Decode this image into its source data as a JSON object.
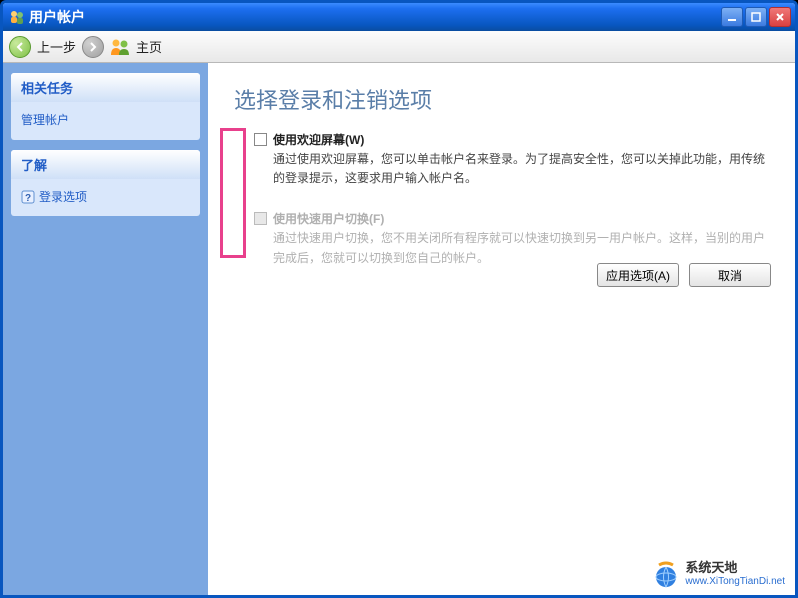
{
  "window": {
    "title": "用户帐户"
  },
  "toolbar": {
    "back": "上一步",
    "home": "主页"
  },
  "sidebar": {
    "panels": [
      {
        "head": "相关任务",
        "links": [
          {
            "label": "管理帐户"
          }
        ]
      },
      {
        "head": "了解",
        "links": [
          {
            "label": "登录选项",
            "icon": true
          }
        ]
      }
    ]
  },
  "main": {
    "title": "选择登录和注销选项",
    "options": [
      {
        "title": "使用欢迎屏幕(W)",
        "desc": "通过使用欢迎屏幕，您可以单击帐户名来登录。为了提高安全性，您可以关掉此功能，用传统的登录提示，这要求用户输入帐户名。",
        "enabled": true
      },
      {
        "title": "使用快速用户切换(F)",
        "desc": "通过快速用户切换，您不用关闭所有程序就可以快速切换到另一用户帐户。这样，当别的用户完成后，您就可以切换到您自己的帐户。",
        "enabled": false
      }
    ],
    "buttons": {
      "apply": "应用选项(A)",
      "cancel": "取消"
    }
  },
  "watermark": {
    "name": "系统天地",
    "url": "www.XiTongTianDi.net"
  }
}
